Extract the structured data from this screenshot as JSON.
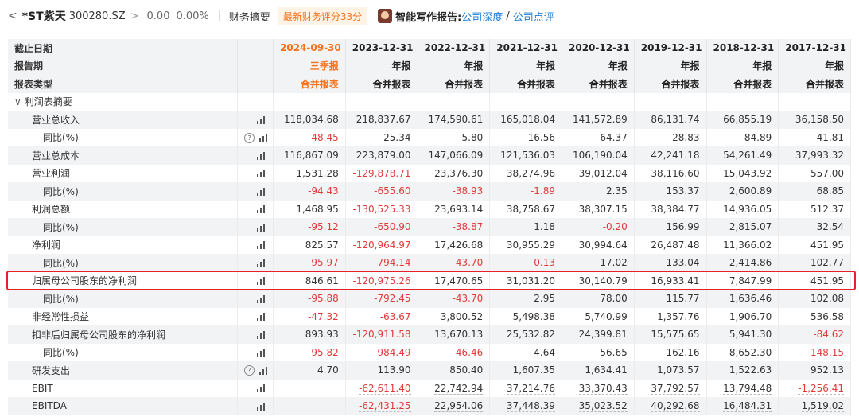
{
  "topbar": {
    "back_glyph": "<",
    "stock_name": "*ST紫天",
    "stock_code": "300280.SZ",
    "arrow": ">",
    "price": "0.00",
    "change_pct": "0.00%",
    "section": "财务摘要",
    "score_badge": "最新财务评分33分",
    "ai_label": "智能写作报告:",
    "link_deep": "公司深度",
    "slash": "/",
    "link_review": "公司点评"
  },
  "table": {
    "header_rows": [
      {
        "label": "截止日期",
        "values": [
          "2024-09-30",
          "2023-12-31",
          "2022-12-31",
          "2021-12-31",
          "2020-12-31",
          "2019-12-31",
          "2018-12-31",
          "2017-12-31"
        ]
      },
      {
        "label": "报告期",
        "values": [
          "三季报",
          "年报",
          "年报",
          "年报",
          "年报",
          "年报",
          "年报",
          "年报"
        ]
      },
      {
        "label": "报表类型",
        "values": [
          "合并报表",
          "合并报表",
          "合并报表",
          "合并报表",
          "合并报表",
          "合并报表",
          "合并报表",
          "合并报表"
        ]
      }
    ],
    "section_title": "利润表摘要",
    "rows": [
      {
        "label": "营业总收入",
        "level": 1,
        "help": false,
        "values": [
          "118,034.68",
          "218,837.67",
          "174,590.61",
          "165,018.04",
          "141,572.89",
          "86,131.74",
          "66,855.19",
          "36,158.50"
        ]
      },
      {
        "label": "同比(%)",
        "level": 2,
        "help": true,
        "values": [
          "-48.45",
          "25.34",
          "5.80",
          "16.56",
          "64.37",
          "28.83",
          "84.89",
          "41.81"
        ]
      },
      {
        "label": "营业总成本",
        "level": 1,
        "help": false,
        "values": [
          "116,867.09",
          "223,879.00",
          "147,066.09",
          "121,536.03",
          "106,190.04",
          "42,241.18",
          "54,261.49",
          "37,993.32"
        ]
      },
      {
        "label": "营业利润",
        "level": 1,
        "help": false,
        "values": [
          "1,531.28",
          "-129,878.71",
          "23,376.30",
          "38,274.96",
          "39,012.04",
          "38,116.60",
          "15,043.92",
          "557.00"
        ]
      },
      {
        "label": "同比(%)",
        "level": 2,
        "help": false,
        "values": [
          "-94.43",
          "-655.60",
          "-38.93",
          "-1.89",
          "2.35",
          "153.37",
          "2,600.89",
          "68.85"
        ]
      },
      {
        "label": "利润总额",
        "level": 1,
        "help": false,
        "values": [
          "1,468.95",
          "-130,525.33",
          "23,693.14",
          "38,758.67",
          "38,307.15",
          "38,384.77",
          "14,936.05",
          "512.37"
        ]
      },
      {
        "label": "同比(%)",
        "level": 2,
        "help": false,
        "values": [
          "-95.12",
          "-650.90",
          "-38.87",
          "1.18",
          "-0.20",
          "156.99",
          "2,815.07",
          "32.54"
        ]
      },
      {
        "label": "净利润",
        "level": 1,
        "help": false,
        "values": [
          "825.57",
          "-120,964.97",
          "17,426.68",
          "30,955.29",
          "30,994.64",
          "26,487.48",
          "11,366.02",
          "451.95"
        ]
      },
      {
        "label": "同比(%)",
        "level": 2,
        "help": false,
        "values": [
          "-95.97",
          "-794.14",
          "-43.70",
          "-0.13",
          "17.02",
          "133.04",
          "2,414.86",
          "102.77"
        ]
      },
      {
        "label": "归属母公司股东的净利润",
        "level": 1,
        "help": false,
        "values": [
          "846.61",
          "-120,975.26",
          "17,470.65",
          "31,031.20",
          "30,140.79",
          "16,933.41",
          "7,847.99",
          "451.95"
        ]
      },
      {
        "label": "同比(%)",
        "level": 2,
        "help": false,
        "values": [
          "-95.88",
          "-792.45",
          "-43.70",
          "2.95",
          "78.00",
          "115.77",
          "1,636.46",
          "102.08"
        ]
      },
      {
        "label": "非经常性损益",
        "level": 1,
        "help": false,
        "values": [
          "-47.32",
          "-63.67",
          "3,800.52",
          "5,498.38",
          "5,740.99",
          "1,357.76",
          "1,906.70",
          "536.58"
        ]
      },
      {
        "label": "扣非后归属母公司股东的净利润",
        "level": 1,
        "help": false,
        "values": [
          "893.93",
          "-120,911.58",
          "13,670.13",
          "25,532.82",
          "24,399.81",
          "15,575.65",
          "5,941.30",
          "-84.62"
        ]
      },
      {
        "label": "同比(%)",
        "level": 2,
        "help": false,
        "values": [
          "-95.82",
          "-984.49",
          "-46.46",
          "4.64",
          "56.65",
          "162.16",
          "8,652.30",
          "-148.15"
        ]
      },
      {
        "label": "研发支出",
        "level": 1,
        "help": true,
        "values": [
          "4.70",
          "113.90",
          "850.40",
          "1,607.35",
          "1,634.41",
          "1,073.57",
          "1,522.63",
          "952.13"
        ]
      },
      {
        "label": "EBIT",
        "level": 1,
        "help": false,
        "values": [
          "",
          "-62,611.40",
          "22,742.94",
          "37,214.76",
          "33,370.43",
          "37,792.57",
          "13,794.48",
          "-1,256.41"
        ]
      },
      {
        "label": "EBITDA",
        "level": 1,
        "help": false,
        "values": [
          "",
          "-62,431.25",
          "22,954.06",
          "37,448.39",
          "35,023.52",
          "40,292.68",
          "16,484.31",
          "1,519.02"
        ]
      }
    ]
  },
  "colors": {
    "accent_orange": "#f5711a",
    "negative_red": "#e23a3a",
    "link_blue": "#1c7cd5",
    "highlight_border": "#e8202a"
  }
}
